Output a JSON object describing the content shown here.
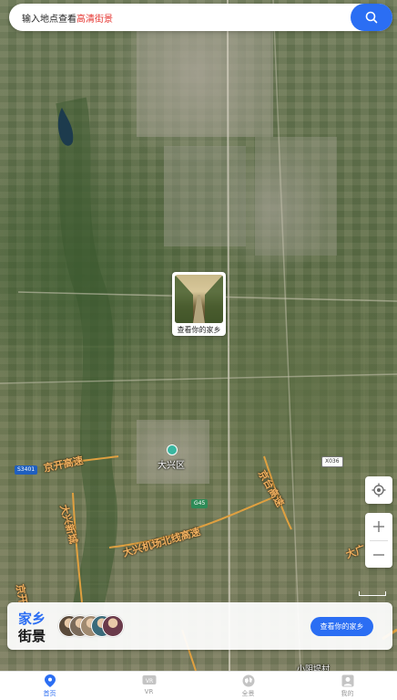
{
  "search": {
    "prefix": "输入地点查看",
    "highlight": "高清街景"
  },
  "map": {
    "center_card_label": "查看你的家乡",
    "road_labels": [
      "京开高速",
      "大兴新城",
      "京台高速",
      "大兴机场北线高速",
      "京开",
      "大广"
    ],
    "place_labels": [
      "大兴区",
      "小阴堤村"
    ],
    "road_signs": [
      "S3401",
      "G45",
      "X036"
    ]
  },
  "promo": {
    "title_line1": "家乡",
    "title_line2": "街景",
    "button_label": "查看你的家乡",
    "avatar_colors": [
      "#5a4a3a",
      "#7a6a5a",
      "#a08a70",
      "#3a6a7a",
      "#6a3a4a"
    ]
  },
  "tabs": [
    {
      "label": "首页",
      "icon": "location-pin-icon",
      "active": true
    },
    {
      "label": "VR",
      "icon": "vr-icon",
      "active": false
    },
    {
      "label": "全景",
      "icon": "globe-icon",
      "active": false
    },
    {
      "label": "我的",
      "icon": "profile-icon",
      "active": false
    }
  ],
  "colors": {
    "accent": "#2b6ef3",
    "highlight": "#e5322d",
    "road_label": "#f0b060"
  }
}
